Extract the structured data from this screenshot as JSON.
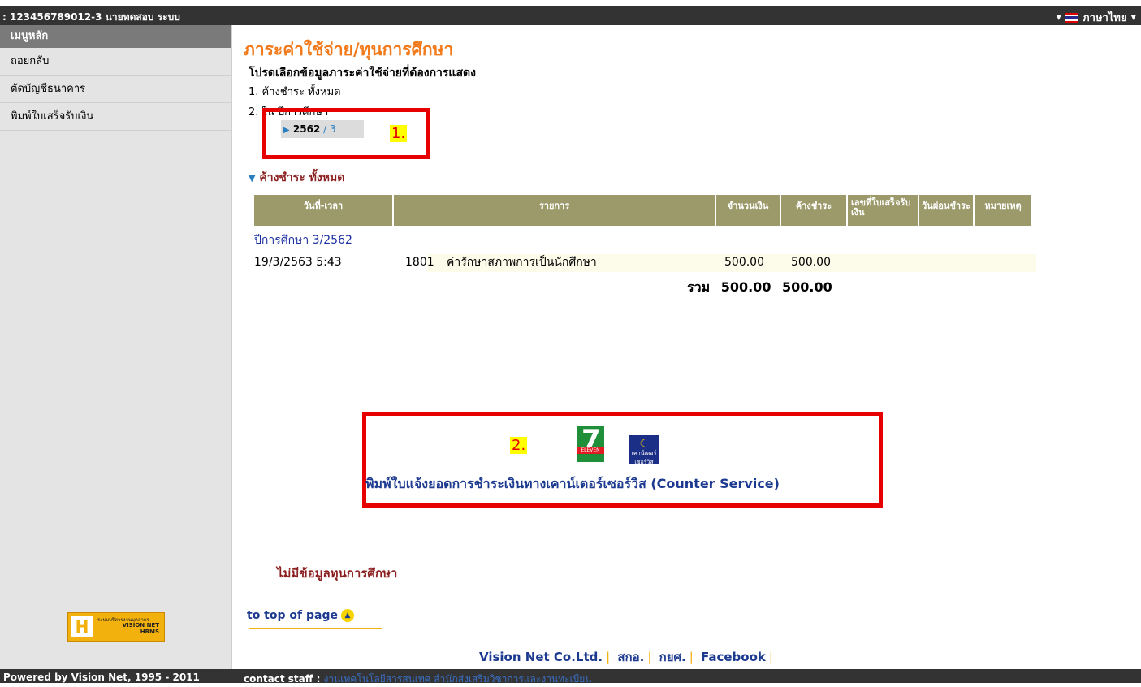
{
  "topbar": {
    "user": ": 123456789012-3 นายทดสอบ ระบบ",
    "language": "ภาษาไทย"
  },
  "sidebar": {
    "header": "เมนูหลัก",
    "items": [
      {
        "label": "ถอยกลับ"
      },
      {
        "label": "ตัดบัญชีธนาคาร"
      },
      {
        "label": "พิมพ์ใบเสร็จรับเงิน"
      }
    ],
    "logo": {
      "line1": "ระบบบริหารงานบุคลากร",
      "line2": "VISION NET",
      "line3": "HRMS"
    }
  },
  "main": {
    "title": "ภาระค่าใช้จ่าย/ทุนการศึกษา",
    "prompt": "โปรดเลือกข้อมูลภาระค่าใช้จ่ายที่ต้องการแสดง",
    "option1": "1. ค้างชำระ ทั้งหมด",
    "option2": "2. ใน ปีการศึกษา",
    "year_select": {
      "year": "2562",
      "sep": " / ",
      "semester": "3"
    },
    "annotation1": "1.",
    "section_title": "ค้างชำระ ทั้งหมด",
    "table": {
      "headers": [
        "วันที่-เวลา",
        "รายการ",
        "จำนวนเงิน",
        "ค้างชำระ",
        "เลขที่ใบเสร็จรับเงิน",
        "วันผ่อนชำระ",
        "หมายเหตุ"
      ],
      "group_label": "ปีการศึกษา 3/2562",
      "rows": [
        {
          "datetime": "19/3/2563 5:43",
          "code": "1801",
          "item": "ค่ารักษาสภาพการเป็นนักศึกษา",
          "amount": "500.00",
          "outstanding": "500.00"
        }
      ],
      "total_label": "รวม",
      "total_amount": "500.00",
      "total_outstanding": "500.00"
    },
    "annotation2": "2.",
    "seven_eleven_label": "ELEVEN",
    "counter_service_label": "เคาน์เตอร์ เซอร์วิส",
    "counter_service_link": "พิมพ์ใบแจ้งยอดการชำระเงินทางเคาน์เตอร์เซอร์วิส (Counter Service)",
    "no_scholarship": "ไม่มีข้อมูลทุนการศึกษา",
    "to_top": "to top of page",
    "bottom_links": [
      "Vision Net Co.Ltd.",
      "สกอ.",
      "กยศ.",
      "Facebook"
    ]
  },
  "footer": {
    "powered": "Powered by Vision Net, 1995 - 2011",
    "contact_label": "contact staff :",
    "contact_link": "งานเทคโนโลยีสารสนเทศ สำนักส่งเสริมวิชาการและงานทะเบียน"
  },
  "colors": {
    "title": "#f27a1a",
    "header_bg": "#9c9a6a",
    "link": "#1c3a8f",
    "annotation_box": "#e60000",
    "dark_bar": "#333333"
  }
}
